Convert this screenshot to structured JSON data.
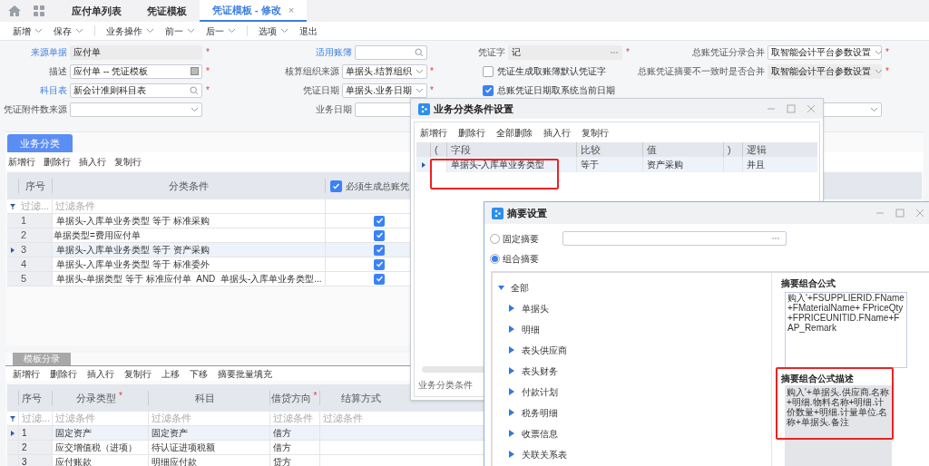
{
  "tabs": [
    {
      "label": "应付单列表",
      "selected": false,
      "closable": false
    },
    {
      "label": "凭证模板",
      "selected": false,
      "closable": false
    },
    {
      "label": "凭证模板 - 修改",
      "selected": true,
      "closable": true
    }
  ],
  "close_glyph": "×",
  "required_glyph": "*",
  "toolbar": [
    {
      "label": "新增",
      "menu": true,
      "divider_after": false
    },
    {
      "label": "保存",
      "menu": true,
      "divider_after": true
    },
    {
      "label": "业务操作",
      "menu": true,
      "divider_after": false
    },
    {
      "label": "前一",
      "menu": true,
      "divider_after": false
    },
    {
      "label": "后一",
      "menu": true,
      "divider_after": true
    },
    {
      "label": "选项",
      "menu": true,
      "divider_after": false
    },
    {
      "label": "退出",
      "menu": false,
      "divider_after": false
    }
  ],
  "form_rows": [
    [
      {
        "kind": "text",
        "label": "来源单据",
        "link": true,
        "value": "应付单",
        "disabled": true,
        "required": true
      },
      {
        "kind": "search",
        "label": "适用账簿",
        "link": true,
        "required": false
      },
      {
        "kind": "lookup",
        "label": "凭证字",
        "value": "记",
        "disabled": true,
        "required": true
      },
      {
        "kind": "select",
        "label": "总账凭证分录合并",
        "value": "取智能会计平台参数设置",
        "required": true
      }
    ],
    [
      {
        "kind": "lang",
        "label": "描述",
        "value": "应付单 -- 凭证模板",
        "required": true
      },
      {
        "kind": "select",
        "label": "核算组织来源",
        "value": "单据头.结算组织",
        "required": true
      },
      {
        "kind": "checkbox",
        "label": "凭证生成取账簿默认凭证字",
        "checked": false
      },
      {
        "kind": "select",
        "label": "总账凭证摘要不一致时是否合并",
        "value": "取智能会计平台参数设置",
        "disabled": true,
        "required": true
      }
    ],
    [
      {
        "kind": "search",
        "label": "科目表",
        "link": true,
        "value": "新会计准则科目表",
        "required": true
      },
      {
        "kind": "select",
        "label": "凭证日期",
        "value": "单据头.业务日期",
        "required": true
      },
      {
        "kind": "checkbox",
        "label": "总账凭证日期取系统当前日期",
        "checked": true
      },
      {
        "kind": "blank"
      }
    ],
    [
      {
        "kind": "select",
        "label": "凭证附件数来源",
        "required": false
      },
      {
        "kind": "text",
        "label": "业务日期"
      },
      {
        "kind": "blank"
      },
      {
        "kind": "select",
        "required": false
      }
    ]
  ],
  "category_panel": {
    "tab": "业务分类",
    "actions": [
      "新增行",
      "删除行",
      "插入行",
      "复制行"
    ],
    "columns": [
      "序号",
      "分类条件",
      "必须生成总账凭"
    ],
    "header_checked": true,
    "filter": [
      "过滤...",
      "过滤条件"
    ],
    "rows": [
      {
        "no": "1",
        "condition": " 单据头-入库单业务类型 等于 标准采购",
        "checked": true,
        "selected": false
      },
      {
        "no": "2",
        "condition": "单据类型=费用应付单",
        "checked": true,
        "selected": false
      },
      {
        "no": "3",
        "condition": " 单据头-入库单业务类型 等于 资产采购",
        "checked": true,
        "selected": true
      },
      {
        "no": "4",
        "condition": " 单据头-入库单业务类型 等于 标准委外",
        "checked": true,
        "selected": false
      },
      {
        "no": "5",
        "condition": " 单据头-单据类型 等于 标准应付单  AND  单据头-入库单业务类型...",
        "checked": true,
        "selected": false
      }
    ]
  },
  "entry_panel": {
    "tab": "模板分录",
    "actions": [
      "新增行",
      "删除行",
      "插入行",
      "复制行",
      "上移",
      "下移",
      "摘要批量填充"
    ],
    "columns": [
      {
        "label": "序号",
        "required": false
      },
      {
        "label": "分录类型",
        "required": true
      },
      {
        "label": "科目",
        "required": false
      },
      {
        "label": "借贷方向",
        "required": true
      },
      {
        "label": "结算方式",
        "required": false
      }
    ],
    "filter": [
      "过滤...",
      "过滤条件",
      "过滤条件",
      "过滤条件",
      "过滤条件"
    ],
    "rows": [
      {
        "no": "1",
        "type": "固定资产",
        "account": "固定资产",
        "direction": "借方",
        "selected": true
      },
      {
        "no": "2",
        "type": "应交增值税（进项）",
        "account": "待认证进项税额",
        "direction": "借方",
        "selected": false
      },
      {
        "no": "3",
        "type": "应付账款",
        "account": "明细应付款",
        "direction": "贷方",
        "selected": false
      }
    ]
  },
  "condition_dialog": {
    "title": "业务分类条件设置",
    "actions": [
      "新增行",
      "删除行",
      "全部删除",
      "插入行",
      "复制行"
    ],
    "columns": [
      "(",
      "字段",
      "比较",
      "值",
      ")",
      "逻辑"
    ],
    "rows": [
      {
        "field": "单据头-入库单业务类型",
        "compare": "等于",
        "value": "资产采购",
        "logic": "并且",
        "selected": true
      }
    ],
    "footer": "业务分类条件"
  },
  "summary_dialog": {
    "title": "摘要设置",
    "options": [
      {
        "label": "固定摘要",
        "selected": false
      },
      {
        "label": "组合摘要",
        "selected": true
      }
    ],
    "tree": {
      "label": "全部",
      "expanded": true,
      "children": [
        {
          "label": "单据头",
          "expanded": false
        },
        {
          "label": "明细",
          "expanded": false
        },
        {
          "label": "表头供应商",
          "expanded": false
        },
        {
          "label": "表头财务",
          "expanded": false
        },
        {
          "label": "付款计划",
          "expanded": false
        },
        {
          "label": "税务明细",
          "expanded": false
        },
        {
          "label": "收票信息",
          "expanded": false
        },
        {
          "label": "关联关系表",
          "expanded": false
        }
      ]
    },
    "formula_label": "摘要组合公式",
    "formula": " 购入'+FSUPPLIERID.FName+FMaterialName+ FPriceQty+FPRICEUNITID.FName+FAP_Remark",
    "description_label": "摘要组合公式描述",
    "description": " 购入'+单据头.供应商.名称+明细.物料名称+明细.计价数量+明细.计量单位.名称+单据头.备注"
  }
}
